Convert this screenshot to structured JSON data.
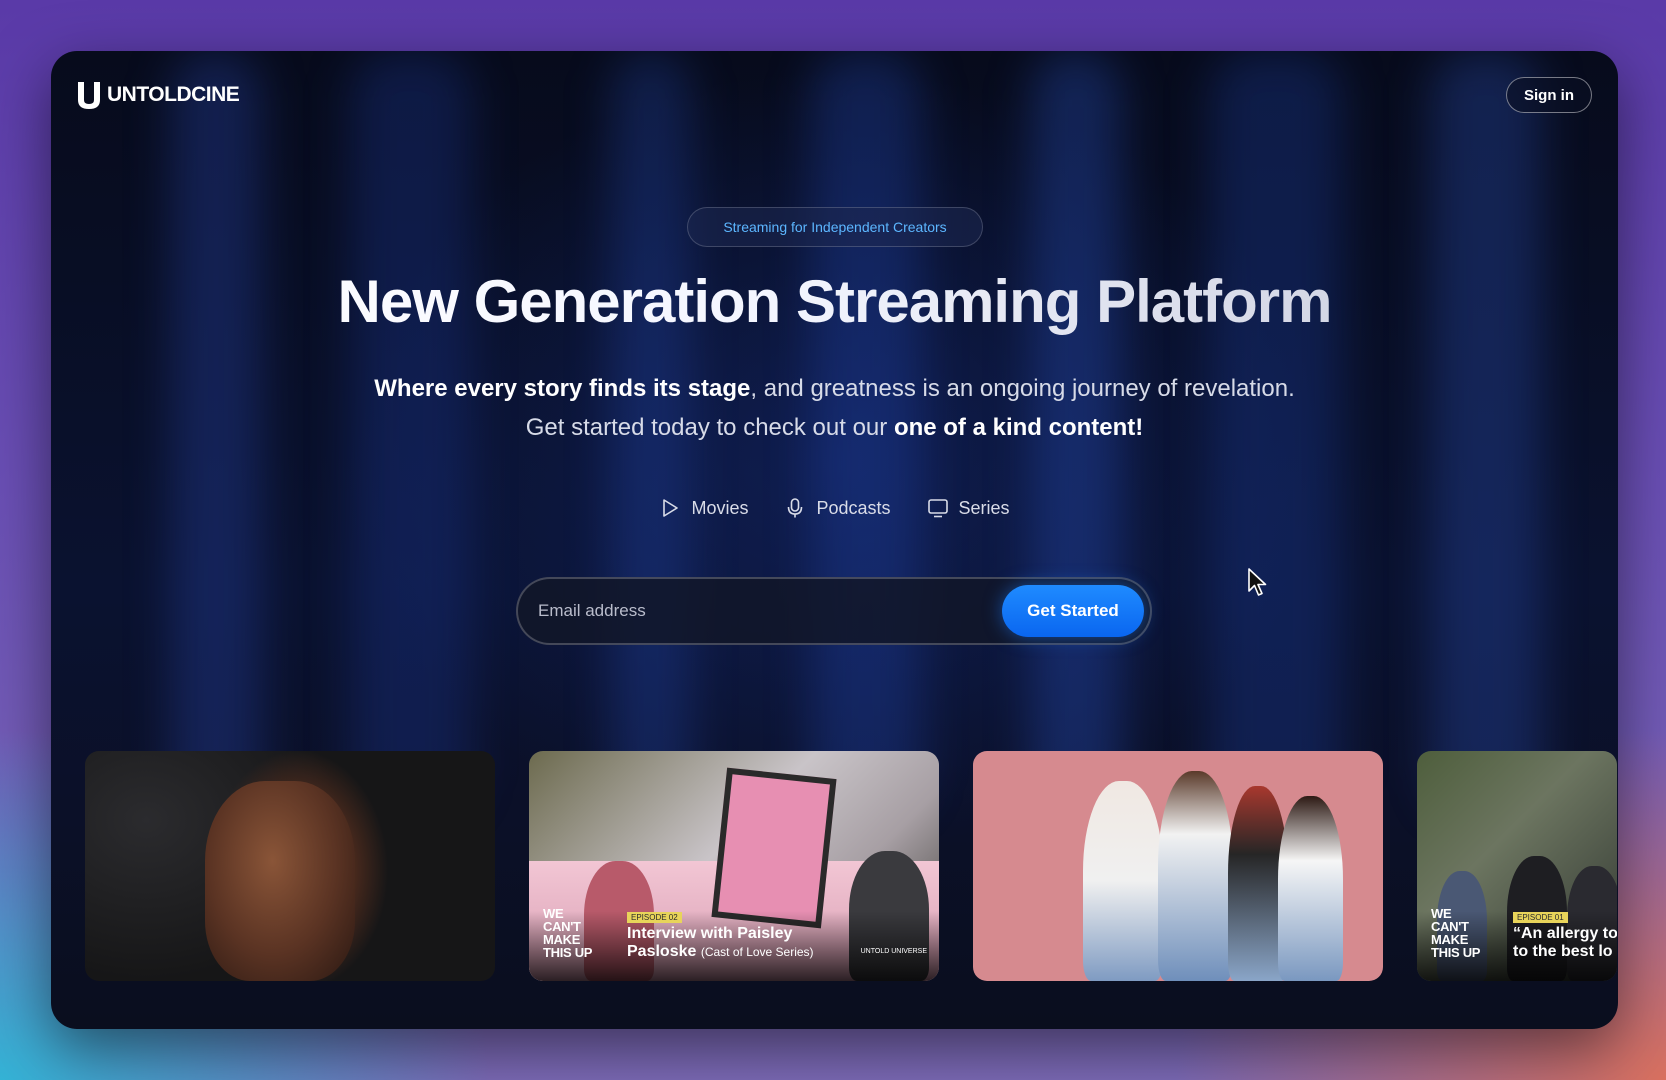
{
  "brand": {
    "logo_text": "UNTOLDCINE",
    "accent": "#1f8bff"
  },
  "nav": {
    "sign_in_label": "Sign in"
  },
  "hero": {
    "badge": "Streaming for Independent Creators",
    "title": "New Generation Streaming Platform",
    "subtitle": {
      "line1_bold": "Where every story finds its stage",
      "line1_rest": ", and greatness is an ongoing journey of revelation.",
      "line2_rest": "Get started today to check out our ",
      "line2_bold": "one of a kind content!"
    }
  },
  "content_types": [
    {
      "label": "Movies",
      "icon": "play-icon"
    },
    {
      "label": "Podcasts",
      "icon": "microphone-icon"
    },
    {
      "label": "Series",
      "icon": "tv-icon"
    }
  ],
  "signup": {
    "email_placeholder": "Email address",
    "cta_label": "Get Started"
  },
  "tiles": [
    {
      "kind": "movie"
    },
    {
      "kind": "podcast",
      "brand": "WE CAN'T MAKE THIS UP",
      "episode": "EPISODE 02",
      "title": "Interview with Paisley",
      "title2": "Pasloske",
      "title_note": "(Cast of Love Series)",
      "studio": "UNTOLD UNIVERSE"
    },
    {
      "kind": "series"
    },
    {
      "kind": "podcast",
      "brand": "WE CAN'T MAKE THIS UP",
      "episode": "EPISODE 01",
      "title": "“An allergy to",
      "title2": "to the best lo"
    }
  ]
}
